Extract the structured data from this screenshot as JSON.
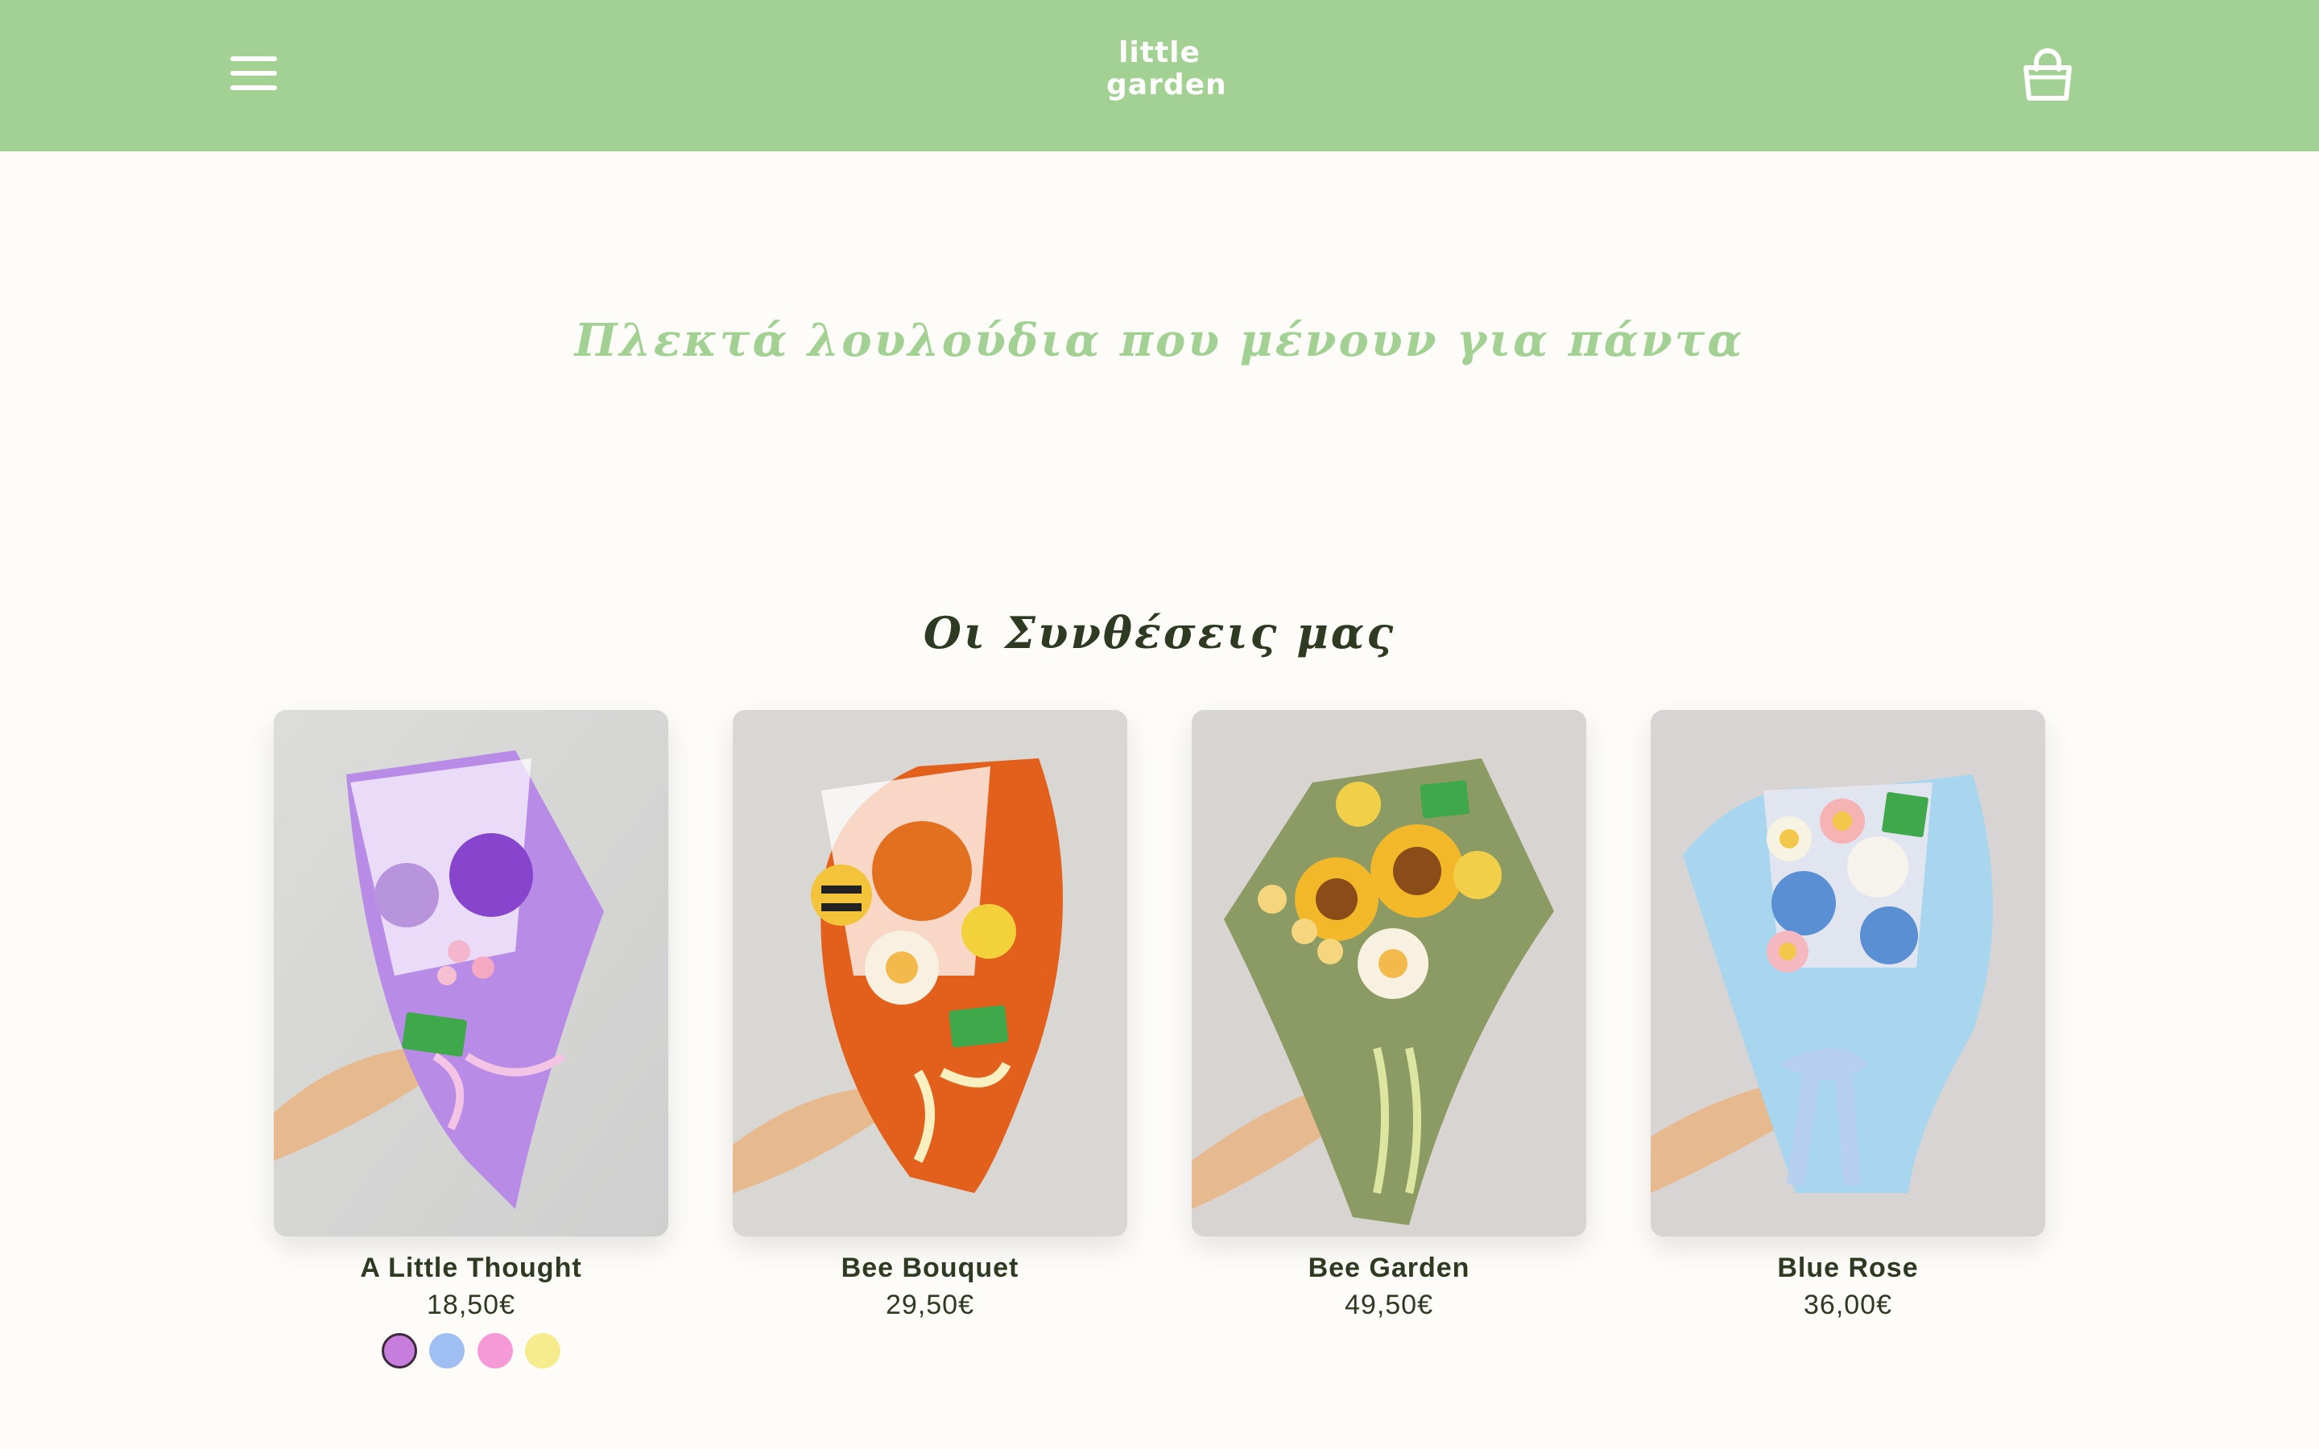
{
  "header": {
    "logo_line1": "little",
    "logo_line2": "garden",
    "menu_icon": "hamburger-menu-icon",
    "cart_icon": "shopping-bag-icon",
    "background": "#a2d193"
  },
  "hero": {
    "tagline": "Πλεκτά λουλούδια που μένουν για πάντα"
  },
  "collection": {
    "title": "Οι Συνθέσεις μας"
  },
  "products": [
    {
      "name": "A Little Thought",
      "price": "18,50€",
      "wrap_color": "#b88be6",
      "swatches": [
        "#c77ddb",
        "#9fbef2",
        "#f59ad6",
        "#f6ec8e"
      ]
    },
    {
      "name": "Bee Bouquet",
      "price": "29,50€",
      "wrap_color": "#e3601c"
    },
    {
      "name": "Bee Garden",
      "price": "49,50€",
      "wrap_color": "#8c9a64"
    },
    {
      "name": "Blue Rose",
      "price": "36,00€",
      "wrap_color": "#a8d6ef"
    }
  ],
  "colors": {
    "brand_green": "#a2d193",
    "text_dark": "#2e3a22",
    "page_bg": "#fdfcf9"
  }
}
